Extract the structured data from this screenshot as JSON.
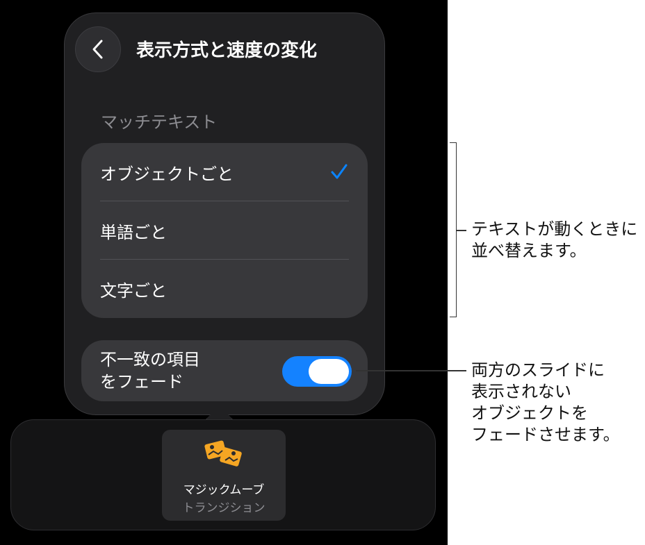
{
  "popover": {
    "title": "表示方式と速度の変化",
    "back_icon": "chevron-left-icon",
    "section_header": "マッチテキスト",
    "options": [
      {
        "label": "オブジェクトごと",
        "selected": true
      },
      {
        "label": "単語ごと",
        "selected": false
      },
      {
        "label": "文字ごと",
        "selected": false
      }
    ],
    "toggle": {
      "label_line1": "不一致の項目",
      "label_line2": "をフェード",
      "on": true
    }
  },
  "transition": {
    "name": "マジックムーブ",
    "type": "トランジション",
    "icon": "magic-move-icon"
  },
  "callouts": {
    "match_text": [
      "テキストが動くときに",
      "並べ替えます。"
    ],
    "fade": [
      "両方のスライドに",
      "表示されない",
      "オブジェクトを",
      "フェードさせます。"
    ]
  },
  "colors": {
    "accent": "#1482ff",
    "checkmark": "#0a84ff",
    "icon": "#f5a623"
  }
}
